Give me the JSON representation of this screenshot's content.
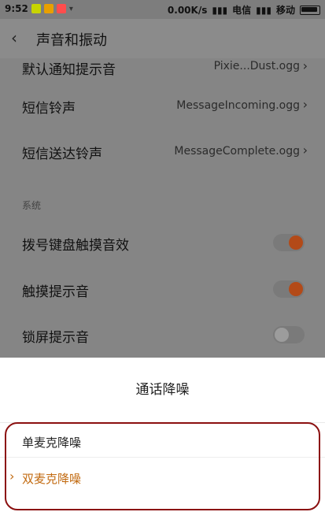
{
  "status_bar": {
    "time": "9:52",
    "network_speed": "0.00K/s",
    "carrier1": "电信",
    "carrier2": "移动"
  },
  "header": {
    "title": "声音和振动"
  },
  "list": {
    "partial_row": {
      "label": "默认通知提示音",
      "value": "Pixie...Dust.ogg"
    },
    "rows": [
      {
        "label": "短信铃声",
        "value": "MessageIncoming.ogg"
      },
      {
        "label": "短信送达铃声",
        "value": "MessageComplete.ogg"
      }
    ],
    "section_title": "系统",
    "toggles": [
      {
        "label": "拨号键盘触摸音效",
        "on": true
      },
      {
        "label": "触摸提示音",
        "on": true
      },
      {
        "label": "锁屏提示音",
        "on": false
      }
    ]
  },
  "sheet": {
    "title": "通话降噪",
    "options": [
      {
        "label": "单麦克降噪",
        "selected": false
      },
      {
        "label": "双麦克降噪",
        "selected": true
      }
    ]
  },
  "colors": {
    "accent": "#c26a10",
    "highlight_border": "#8b1010"
  }
}
